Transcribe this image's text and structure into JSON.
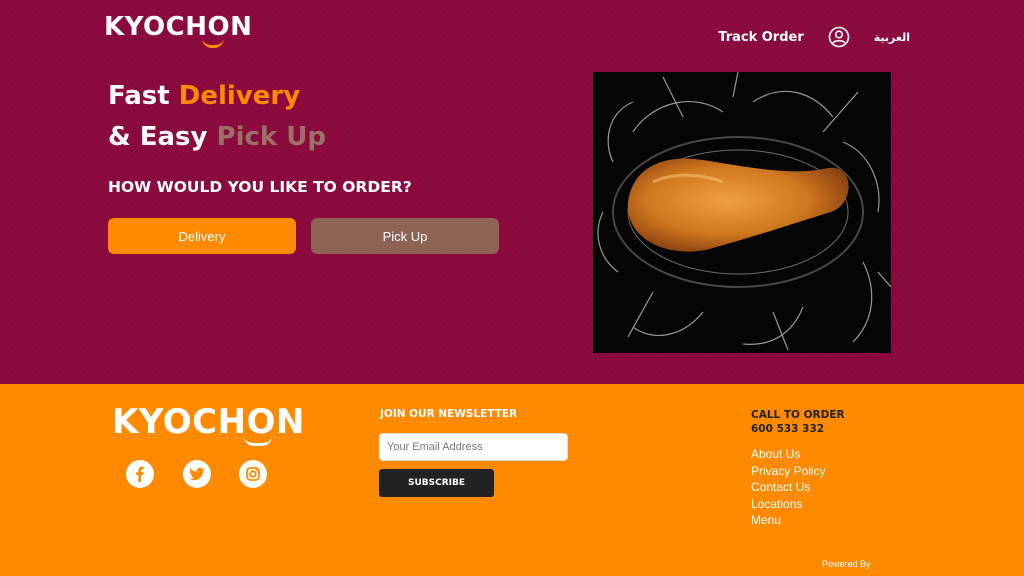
{
  "header": {
    "logo_text": "KYOCHON",
    "track_order_label": "Track Order",
    "account_icon": "user-circle-icon",
    "language_label": "العربية"
  },
  "hero": {
    "headline_line1_white": "Fast ",
    "headline_line1_orange": "Delivery",
    "headline_line2_white": "& Easy ",
    "headline_line2_muted": "Pick Up",
    "question": "HOW WOULD YOU LIKE TO ORDER?",
    "delivery_label": "Delivery",
    "pickup_label": "Pick Up",
    "image_icon": "fried-chicken-drumstick-splash-image"
  },
  "footer": {
    "logo_text": "KYOCHON",
    "social": [
      {
        "icon": "facebook-icon"
      },
      {
        "icon": "twitter-icon"
      },
      {
        "icon": "instagram-icon"
      }
    ],
    "newsletter_title": "JOIN OUR NEWSLETTER",
    "email_placeholder": "Your Email Address",
    "subscribe_label": "SUBSCRIBE",
    "call_title": "CALL TO ORDER",
    "phone": "600 533 332",
    "links": [
      "About Us",
      "Privacy Policy",
      "Contact Us",
      "Locations",
      "Menu"
    ],
    "powered_by": "Powered By"
  },
  "colors": {
    "hero_background": "#8b0b3e",
    "accent_orange": "#ff8a00",
    "pickup_button": "#8e6356",
    "subscribe_button": "#222222"
  }
}
